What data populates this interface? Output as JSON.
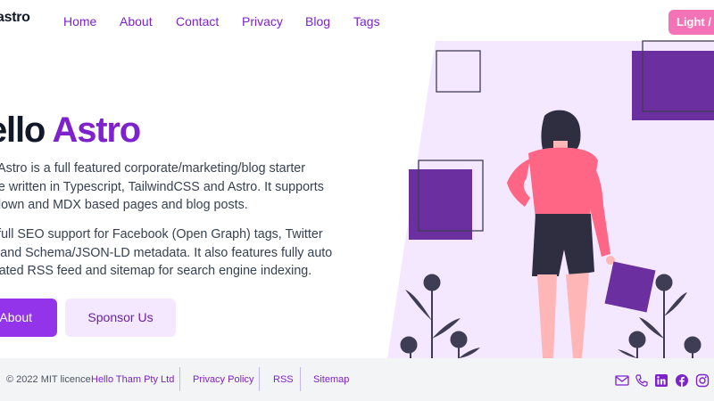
{
  "header": {
    "logo": "astro",
    "nav": [
      "Home",
      "About",
      "Contact",
      "Privacy",
      "Blog",
      "Tags"
    ],
    "theme_toggle": "Light / Dark"
  },
  "hero": {
    "title_part1": "ello ",
    "title_part2": "Astro",
    "paragraph1_lines": [
      "o Astro is a full featured corporate/marketing/blog starter",
      "me written in Typescript, TailwindCSS and Astro. It supports",
      "kdown and MDX based pages and blog posts."
    ],
    "paragraph2_lines": [
      "s full SEO support for Facebook (Open Graph) tags, Twitter",
      "ls and Schema/JSON-LD metadata. It also features fully auto",
      "erated RSS feed and sitemap for search engine indexing."
    ],
    "primary_button": "About",
    "secondary_button": "Sponsor Us"
  },
  "footer": {
    "copyright": "© 2022 MIT licence",
    "company": "Hello Tham Pty Ltd",
    "links": [
      "Privacy Policy",
      "RSS",
      "Sitemap"
    ],
    "social_icons": [
      "mail-icon",
      "phone-icon",
      "linkedin-icon",
      "facebook-icon",
      "instagram-icon"
    ]
  },
  "colors": {
    "brand_purple": "#7e22ce",
    "accent_pink": "#f472b6",
    "illustration_lavender": "#f3e8ff",
    "illustration_purple": "#6b2fa0",
    "figure_shirt": "#ff6584"
  }
}
